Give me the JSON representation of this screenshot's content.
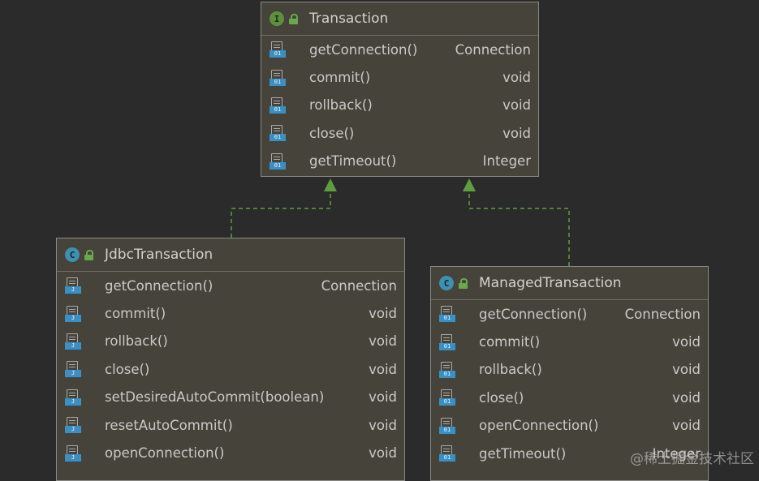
{
  "classes": {
    "transaction": {
      "name": "Transaction",
      "kind": "I",
      "methods": [
        {
          "name": "getConnection()",
          "type": "Connection"
        },
        {
          "name": "commit()",
          "type": "void"
        },
        {
          "name": "rollback()",
          "type": "void"
        },
        {
          "name": "close()",
          "type": "void"
        },
        {
          "name": "getTimeout()",
          "type": "Integer"
        }
      ]
    },
    "jdbc": {
      "name": "JdbcTransaction",
      "kind": "C",
      "methods": [
        {
          "name": "getConnection()",
          "type": "Connection"
        },
        {
          "name": "commit()",
          "type": "void"
        },
        {
          "name": "rollback()",
          "type": "void"
        },
        {
          "name": "close()",
          "type": "void"
        },
        {
          "name": "setDesiredAutoCommit(boolean)",
          "type": "void"
        },
        {
          "name": "resetAutoCommit()",
          "type": "void"
        },
        {
          "name": "openConnection()",
          "type": "void"
        }
      ]
    },
    "managed": {
      "name": "ManagedTransaction",
      "kind": "C",
      "methods": [
        {
          "name": "getConnection()",
          "type": "Connection"
        },
        {
          "name": "commit()",
          "type": "void"
        },
        {
          "name": "rollback()",
          "type": "void"
        },
        {
          "name": "close()",
          "type": "void"
        },
        {
          "name": "openConnection()",
          "type": "void"
        },
        {
          "name": "getTimeout()",
          "type": "Integer"
        }
      ]
    }
  },
  "icon_tags": {
    "interface_methods": "01",
    "jdbc_methods": "J",
    "managed_methods": "01"
  },
  "colors": {
    "background": "#2b2b2b",
    "box_fill": "#46433a",
    "edge": "#5f9e3e",
    "interface_badge": "#5e8f3e",
    "class_badge": "#3f8fb0"
  },
  "watermark": "@稀土掘金技术社区"
}
